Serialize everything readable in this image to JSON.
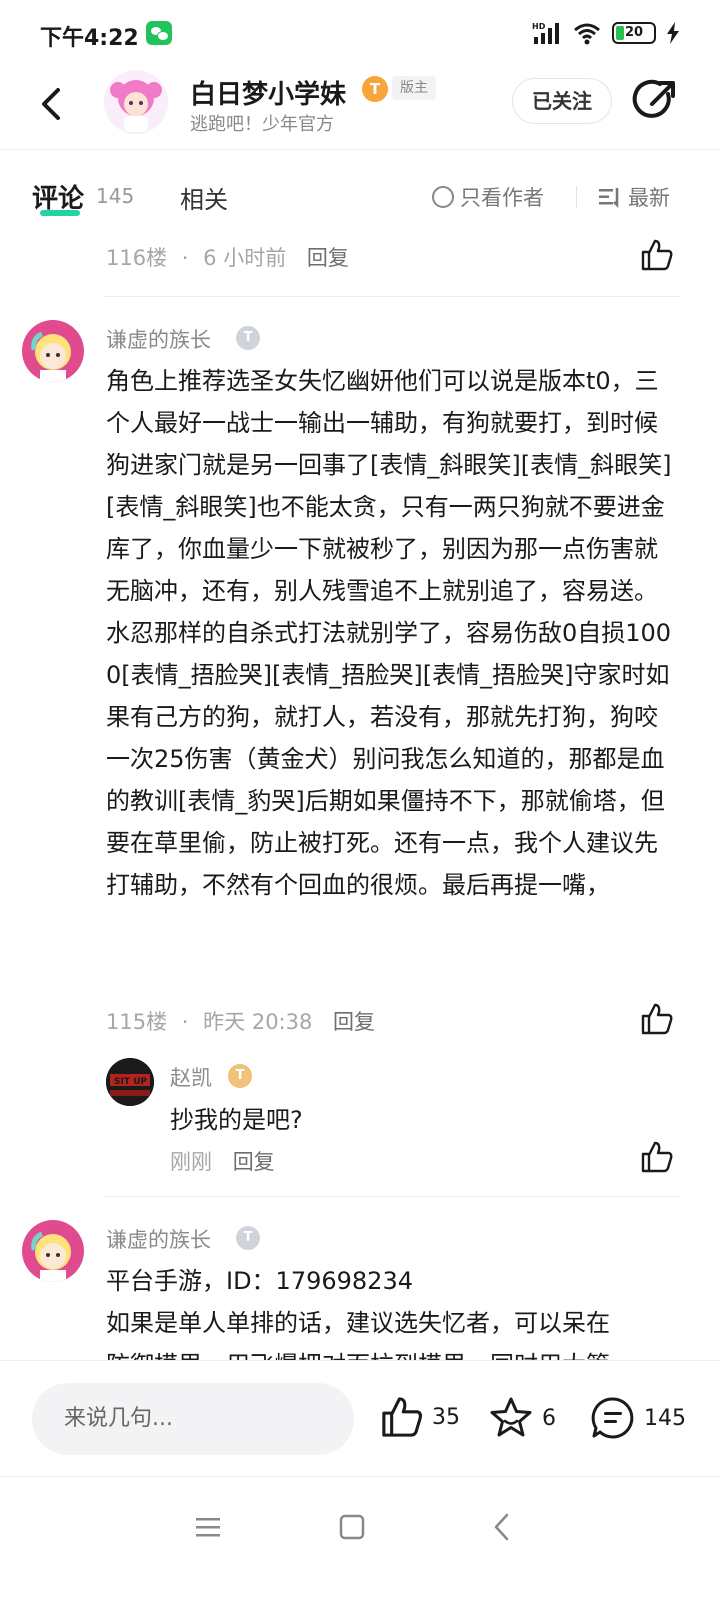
{
  "status_bar": {
    "time": "下午4:22",
    "battery": "20"
  },
  "header": {
    "title": "白日梦小学妹",
    "level_badge": "T",
    "mod_badge": "版主",
    "subtitle": "逃跑吧！少年官方",
    "follow_label": "已关注"
  },
  "tabs": {
    "comment_label": "评论",
    "comment_count": "145",
    "related_label": "相关",
    "author_only_label": "只看作者",
    "sort_label": "最新"
  },
  "comments": [
    {
      "floor": "116楼",
      "time": "6 小时前",
      "reply_label": "回复"
    },
    {
      "user": "谦虚的族长",
      "level": "T",
      "body": "角色上推荐选圣女失忆幽妍他们可以说是版本t0，三个人最好一战士一输出一辅助，有狗就要打，到时候狗进家门就是另一回事了[表情_斜眼笑][表情_斜眼笑][表情_斜眼笑]也不能太贪，只有一两只狗就不要进金库了，你血量少一下就被秒了，别因为那一点伤害就无脑冲，还有，别人残雪追不上就别追了，容易送。水忍那样的自杀式打法就别学了，容易伤敌0自损1000[表情_捂脸哭][表情_捂脸哭][表情_捂脸哭]守家时如果有己方的狗，就打人，若没有，那就先打狗，狗咬一次25伤害（黄金犬）别问我怎么知道的，那都是血的教训[表情_豹哭]后期如果僵持不下，那就偷塔，但要在草里偷，防止被打死。还有一点，我个人建议先打辅助，不然有个回血的很烦。最后再提一嘴，",
      "floor": "115楼",
      "time": "昨天 20:38",
      "reply_label": "回复",
      "sub_reply": {
        "user": "赵凯",
        "level": "T",
        "avatar_text": "SIT UP",
        "body": "抄我的是吧?",
        "time": "刚刚",
        "reply_label": "回复"
      }
    },
    {
      "user": "谦虚的族长",
      "level": "T",
      "line1": "平台手游，ID：179698234",
      "line2": "如果是单人单排的话，建议选失忆者，可以呆在",
      "line3": "防御模里，用飞爆把对面拉到模里，同时用大管"
    }
  ],
  "bottom_bar": {
    "input_placeholder": "来说几句...",
    "like_count": "35",
    "star_count": "6",
    "comment_count": "145"
  },
  "colors": {
    "accent": "#22d3a6",
    "badge_orange": "#f6a53b",
    "level_grey": "#cfd4da",
    "level_gold": "#f0c27a"
  }
}
